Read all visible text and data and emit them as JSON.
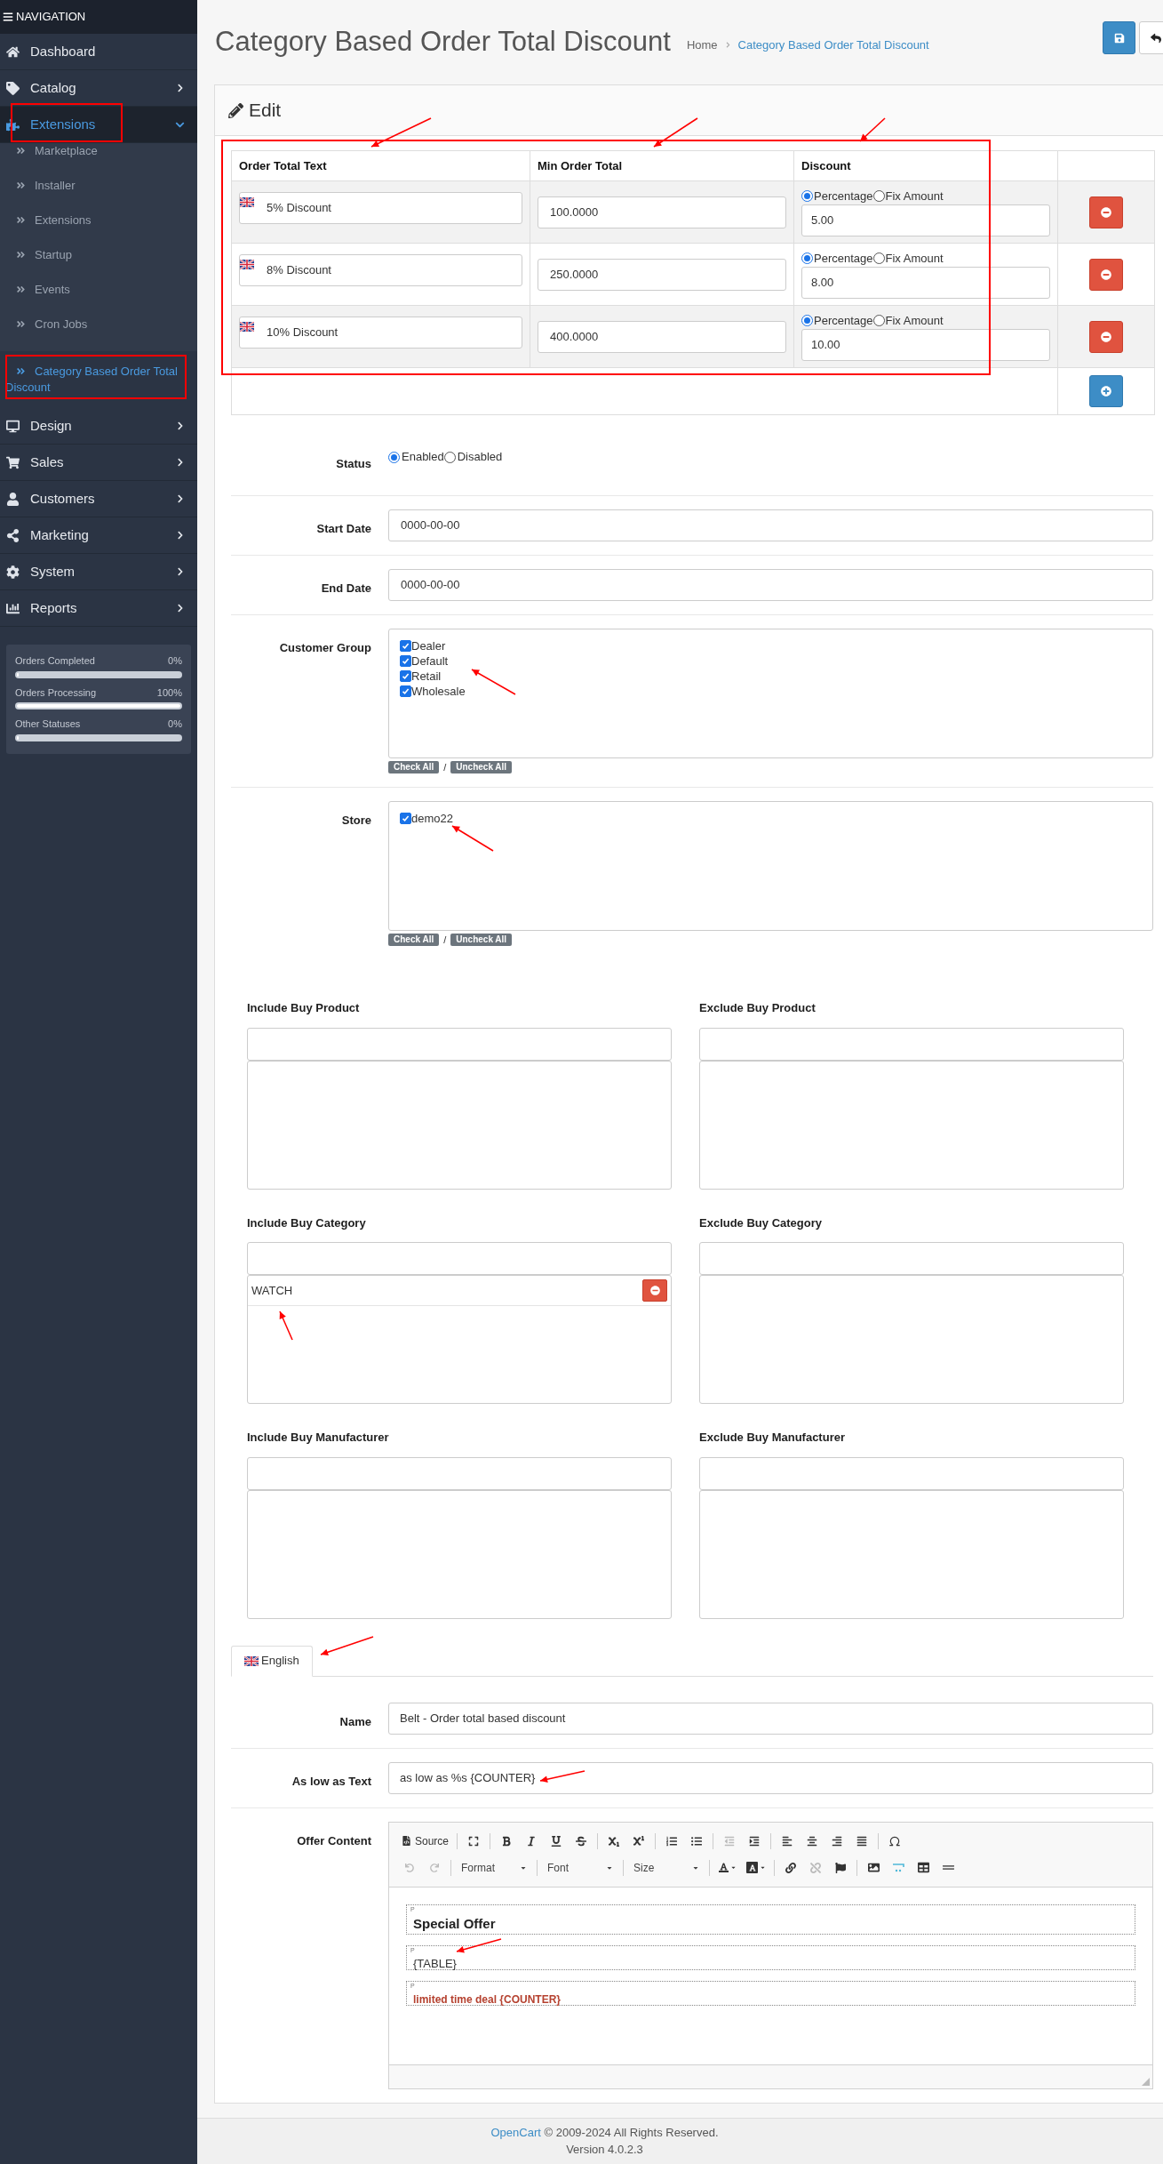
{
  "sidebar": {
    "header": "NAVIGATION",
    "items": [
      {
        "label": "Dashboard",
        "expandable": false,
        "selected": false
      },
      {
        "label": "Catalog",
        "expandable": true,
        "expanded": false,
        "selected": false
      },
      {
        "label": "Extensions",
        "expandable": true,
        "expanded": true,
        "selected": true,
        "children": [
          {
            "label": "Marketplace",
            "selected": false
          },
          {
            "label": "Installer",
            "selected": false
          },
          {
            "label": "Extensions",
            "selected": false
          },
          {
            "label": "Startup",
            "selected": false
          },
          {
            "label": "Events",
            "selected": false
          },
          {
            "label": "Cron Jobs",
            "selected": false
          },
          {
            "label": "Category Based Order Total Discount",
            "selected": true
          }
        ]
      },
      {
        "label": "Design",
        "expandable": true,
        "expanded": false,
        "selected": false
      },
      {
        "label": "Sales",
        "expandable": true,
        "expanded": false,
        "selected": false
      },
      {
        "label": "Customers",
        "expandable": true,
        "expanded": false,
        "selected": false
      },
      {
        "label": "Marketing",
        "expandable": true,
        "expanded": false,
        "selected": false
      },
      {
        "label": "System",
        "expandable": true,
        "expanded": false,
        "selected": false
      },
      {
        "label": "Reports",
        "expandable": true,
        "expanded": false,
        "selected": false
      }
    ],
    "stats": [
      {
        "label": "Orders Completed",
        "reading": "0%",
        "level": 0
      },
      {
        "label": "Orders Processing",
        "reading": "100%",
        "level": 1
      },
      {
        "label": "Other Statuses",
        "reading": "0%",
        "level": 0
      }
    ]
  },
  "header": {
    "title": "Category Based Order Total Discount",
    "breadcrumb": [
      "Home",
      "Category Based Order Total Discount"
    ]
  },
  "panel": {
    "heading": "Edit"
  },
  "table": {
    "columns": [
      "Order Total Text",
      "Min Order Total",
      "Discount"
    ],
    "rows": [
      {
        "text": "5% Discount",
        "min": "100.0000",
        "options": [
          {
            "label": "Percentage",
            "selected": true
          },
          {
            "label": "Fix Amount",
            "selected": false
          }
        ],
        "amount": "5.00"
      },
      {
        "text": "8% Discount",
        "min": "250.0000",
        "options": [
          {
            "label": "Percentage",
            "selected": true
          },
          {
            "label": "Fix Amount",
            "selected": false
          }
        ],
        "amount": "8.00"
      },
      {
        "text": "10% Discount",
        "min": "400.0000",
        "options": [
          {
            "label": "Percentage",
            "selected": true
          },
          {
            "label": "Fix Amount",
            "selected": false
          }
        ],
        "amount": "10.00"
      }
    ]
  },
  "status": {
    "label": "Status",
    "options": [
      {
        "label": "Enabled",
        "selected": true
      },
      {
        "label": "Disabled",
        "selected": false
      }
    ]
  },
  "start_date": {
    "label": "Start Date",
    "value": "0000-00-00"
  },
  "end_date": {
    "label": "End Date",
    "value": "0000-00-00"
  },
  "customer_group": {
    "label": "Customer Group",
    "items": [
      {
        "label": "Dealer",
        "checked": true
      },
      {
        "label": "Default",
        "checked": true
      },
      {
        "label": "Retail",
        "checked": true
      },
      {
        "label": "Wholesale",
        "checked": true
      }
    ],
    "check_all": "Check All",
    "separator": "/",
    "uncheck_all": "Uncheck All"
  },
  "store": {
    "label": "Store",
    "items": [
      {
        "label": "demo22",
        "checked": true
      }
    ],
    "check_all": "Check All",
    "separator": "/",
    "uncheck_all": "Uncheck All"
  },
  "filters": [
    {
      "label": "Include Buy Product"
    },
    {
      "label": "Exclude Buy Product"
    },
    {
      "label": "Include Buy Category",
      "entries": [
        "WATCH"
      ]
    },
    {
      "label": "Exclude Buy Category"
    },
    {
      "label": "Include Buy Manufacturer"
    },
    {
      "label": "Exclude Buy Manufacturer"
    }
  ],
  "language_tabs": [
    {
      "label": "English",
      "selected": true
    }
  ],
  "name": {
    "label": "Name",
    "value": "Belt - Order total based discount"
  },
  "as_low_as": {
    "label": "As low as Text",
    "value": "as low as %s {COUNTER}"
  },
  "offer_content": {
    "label": "Offer Content",
    "source": "Source",
    "dropdowns": [
      "Format",
      "Font",
      "Size"
    ],
    "paragraphs": [
      {
        "kind": "heading",
        "tag": "P",
        "text": "Special Offer"
      },
      {
        "kind": "plain",
        "tag": "P",
        "text": "{TABLE}"
      },
      {
        "kind": "highlight",
        "tag": "P",
        "text": "limited time deal {COUNTER}"
      }
    ]
  },
  "footer": {
    "link": "OpenCart",
    "text": "© 2009-2024 All Rights Reserved.",
    "version": "Version 4.0.2.3"
  }
}
